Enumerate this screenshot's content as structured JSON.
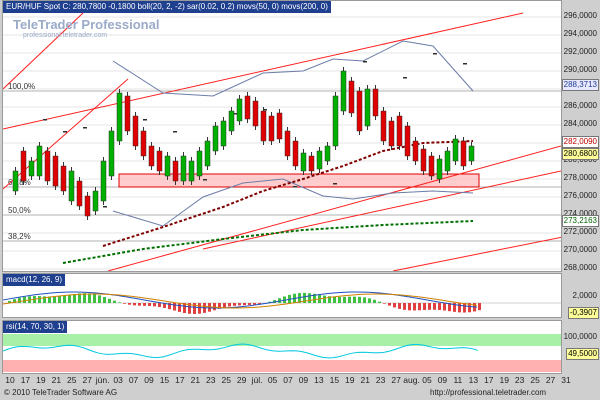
{
  "main_pane": {
    "title": "EUR/HUF Spot C: 280,7800 -0,1800 boll(20, 2, -2) sar(0.02, 0.2) movs(50, 0) movs(200, 0)",
    "logo_title": "TeleTrader Professional",
    "logo_url": "professional.teletrader.com",
    "fib_labels": [
      "100,0%",
      "61,8%",
      "50,0%",
      "38,2%"
    ],
    "y_ticks": [
      "296,0000",
      "294,0000",
      "292,0000",
      "290,0000",
      "288,0000",
      "286,0000",
      "284,0000",
      "282,0000",
      "280,0000",
      "278,0000",
      "276,0000",
      "274,0000",
      "272,0000",
      "270,0000",
      "268,0000"
    ],
    "markers": [
      {
        "label": "288,3713",
        "bg": "#e8e8ff",
        "fg": "#1f3f8f",
        "value": 288.37
      },
      {
        "label": "282,0090",
        "bg": "#ffffff",
        "fg": "#c00000",
        "value": 282.01
      },
      {
        "label": "280,6800",
        "bg": "#ffff99",
        "fg": "#000000",
        "value": 280.68
      },
      {
        "label": "273,2163",
        "bg": "#ffffff",
        "fg": "#006400",
        "value": 273.22
      }
    ],
    "y_range": [
      268,
      296.7
    ]
  },
  "macd_pane": {
    "title": "macd(12, 26, 9)",
    "y_ticks": [
      "2,0000",
      "0,0000"
    ],
    "marker": {
      "label": "-0,3907",
      "bg": "#ffff99",
      "fg": "#000000"
    }
  },
  "rsi_pane": {
    "title": "rsi(14, 70, 30, 1)",
    "y_ticks": [
      "100,0000",
      "50,0000"
    ],
    "marker": {
      "label": "49,5000",
      "bg": "#ffff99",
      "fg": "#000000"
    }
  },
  "x_axis": {
    "labels": [
      "10",
      "17",
      "19",
      "21",
      "25",
      "27",
      "jún.",
      "03",
      "07",
      "09",
      "15",
      "17",
      "21",
      "23",
      "25",
      "29",
      "júl.",
      "05",
      "07",
      "09",
      "13",
      "15",
      "19",
      "21",
      "23",
      "27",
      "aug.",
      "05",
      "09",
      "11",
      "13",
      "17",
      "19",
      "23",
      "25",
      "27",
      "31"
    ]
  },
  "footer": {
    "copyright": "© 2010 TeleTrader Software AG",
    "url": "http://professional.teletrader.com"
  },
  "colors": {
    "title_bg": "#1f3f8f",
    "up_candle": "#00b000",
    "down_candle": "#e00000",
    "trend_line": "#ff2020",
    "ma200": "#007000",
    "ma50": "#800000",
    "rsi_line": "#00c8e0"
  }
}
